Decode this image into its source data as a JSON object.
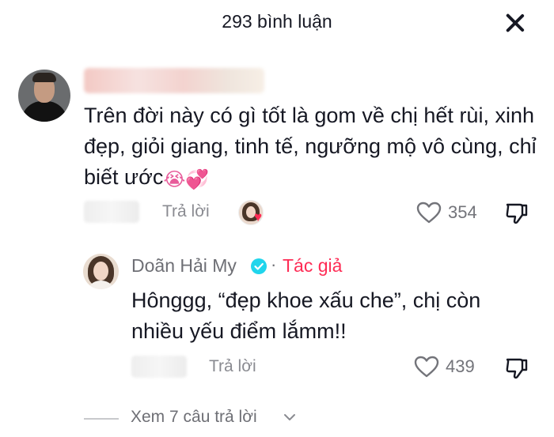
{
  "header": {
    "title": "293 bình luận"
  },
  "comments": [
    {
      "text": "Trên đời này có gì tốt là gom về chị hết rùi, xinh đẹp, giỏi giang, tinh tế, ngưỡng mộ vô cùng, chỉ biết ước",
      "emojis": [
        "😭",
        "💞"
      ],
      "reply_label": "Trả lời",
      "likes": "354",
      "creator_liked": true,
      "replies": [
        {
          "author": "Doãn Hải My",
          "author_badge": "Tác giả",
          "separator": "·",
          "text_line1": "Hônggg, “đẹp khoe xấu che”, chị còn",
          "text_line2": "nhiều yếu điểm lắmm!!",
          "reply_label": "Trả lời",
          "likes": "439"
        }
      ],
      "view_replies": "Xem 7 câu trả lời"
    }
  ],
  "colors": {
    "text": "#161823",
    "secondary": "#8a8b91",
    "accent": "#fe2c55",
    "verified": "#20d5ec"
  },
  "icons": [
    "close-icon",
    "heart-outline-icon",
    "dislike-icon",
    "verified-badge-icon",
    "chevron-down-icon"
  ]
}
